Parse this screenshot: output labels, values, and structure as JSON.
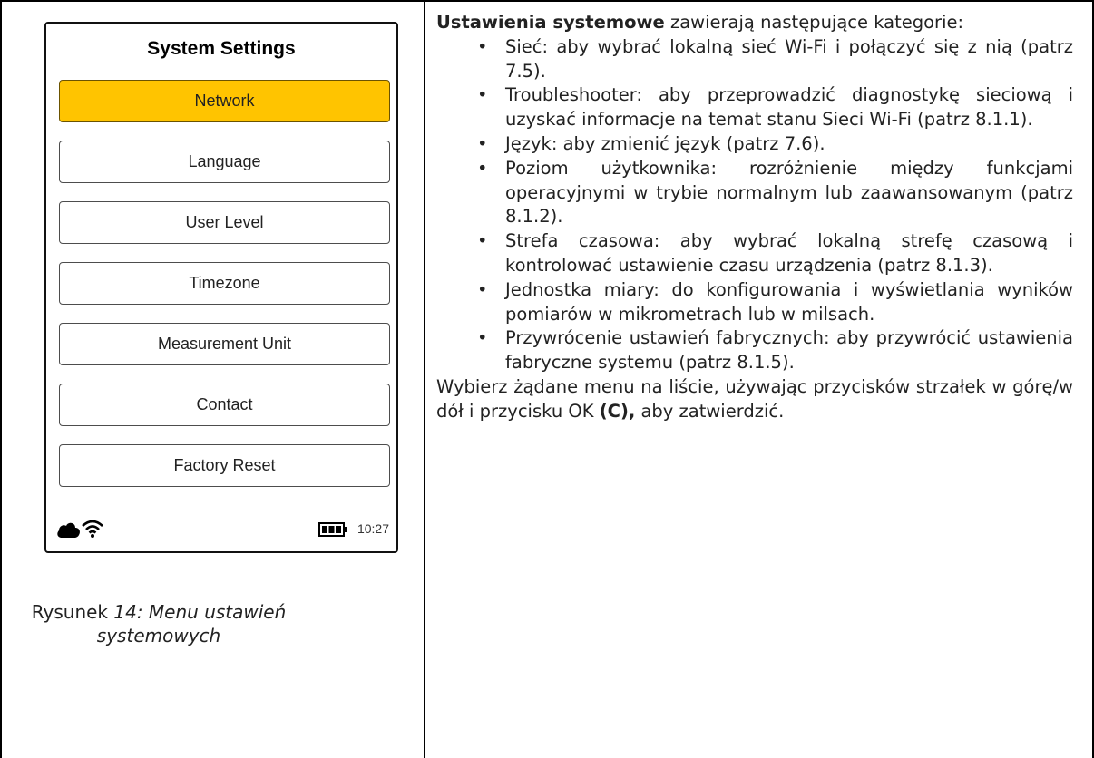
{
  "device": {
    "title": "System Settings",
    "menu": [
      {
        "label": "Network",
        "selected": true
      },
      {
        "label": "Language",
        "selected": false
      },
      {
        "label": "User Level",
        "selected": false
      },
      {
        "label": "Timezone",
        "selected": false
      },
      {
        "label": "Measurement Unit",
        "selected": false
      },
      {
        "label": "Contact",
        "selected": false
      },
      {
        "label": "Factory Reset",
        "selected": false
      }
    ],
    "status": {
      "time": "10:27",
      "icons": [
        "cloud-icon",
        "wifi-icon",
        "battery-icon"
      ]
    },
    "accent": "#ffc400"
  },
  "caption": {
    "prefix": "Rysunek ",
    "italic": "14: Menu ustawień systemowych"
  },
  "text": {
    "intro_bold": "Ustawienia systemowe",
    "intro_rest": " zawierają następujące kategorie:",
    "items": [
      "Sieć: aby wybrać lokalną sieć Wi-Fi i połączyć się z nią (patrz 7.5).",
      "Troubleshooter: aby przeprowadzić diagnostykę sieciową i uzyskać informacje na temat stanu Sieci Wi-Fi (patrz 8.1.1).",
      "Język: aby zmienić język (patrz 7.6).",
      "Poziom użytkownika: rozróżnienie między funkcjami operacyjnymi w trybie normalnym lub zaawansowanym (patrz 8.1.2).",
      "Strefa czasowa: aby wybrać lokalną strefę czasową i kontrolować ustawienie czasu urządzenia (patrz 8.1.3).",
      "Jednostka miary: do konfigurowania i wyświetlania wyników pomiarów w mikrometrach lub w milsach.",
      "Przywrócenie ustawień fabrycznych: aby przywrócić ustawienia fabryczne systemu (patrz 8.1.5)."
    ],
    "outro_start": "Wybierz żądane menu na liście, używając przycisków strzałek w górę/w dół i przycisku OK ",
    "outro_bold": "(C),",
    "outro_end": " aby zatwierdzić."
  }
}
